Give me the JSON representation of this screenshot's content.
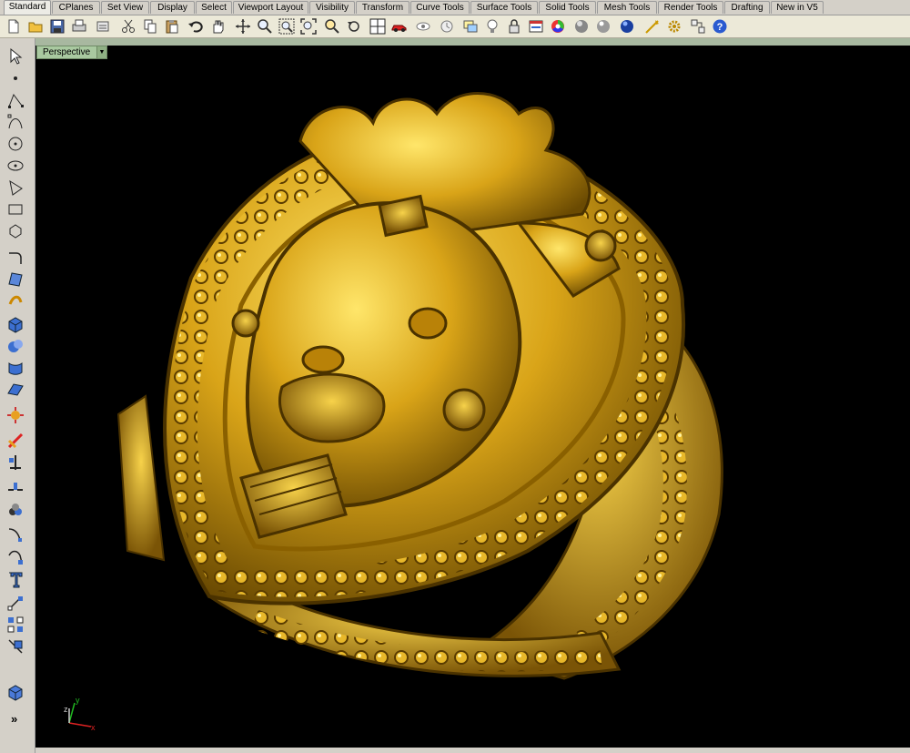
{
  "tabs": [
    {
      "label": "Standard",
      "active": true
    },
    {
      "label": "CPlanes"
    },
    {
      "label": "Set View"
    },
    {
      "label": "Display"
    },
    {
      "label": "Select"
    },
    {
      "label": "Viewport Layout"
    },
    {
      "label": "Visibility"
    },
    {
      "label": "Transform"
    },
    {
      "label": "Curve Tools"
    },
    {
      "label": "Surface Tools"
    },
    {
      "label": "Solid Tools"
    },
    {
      "label": "Mesh Tools"
    },
    {
      "label": "Render Tools"
    },
    {
      "label": "Drafting"
    },
    {
      "label": "New in V5"
    }
  ],
  "toolbar_icons": [
    "new-file-icon",
    "open-folder-icon",
    "save-icon",
    "print-icon",
    "import-icon",
    "cut-icon",
    "copy-icon",
    "paste-icon",
    "undo-icon",
    "pan-hand-icon",
    "rotate-view-icon",
    "zoom-icon",
    "zoom-window-icon",
    "zoom-extents-icon",
    "zoom-selected-icon",
    "undo-view-icon",
    "four-viewports-icon",
    "car-icon",
    "show-icon",
    "lock-icon",
    "layer-icon",
    "light-bulb-icon",
    "padlock-icon",
    "properties-icon",
    "color-wheel-icon",
    "sphere-shaded-icon",
    "sphere-rendered-icon",
    "globe-icon",
    "render-icon",
    "options-gear-icon",
    "toolbar-layout-icon",
    "help-icon"
  ],
  "left_tools": [
    "select-arrow-icon",
    "point-icon",
    "polyline-icon",
    "curve-icon",
    "circle-icon",
    "ellipse-icon",
    "polygon-icon",
    "rectangle-icon",
    "arc-icon",
    "fillet-curve-icon",
    "surface-corner-icon",
    "extrude-icon",
    "box-solid-icon",
    "boolean-icon",
    "loft-icon",
    "plane-surface-icon",
    "explode-icon",
    "trim-icon",
    "split-icon",
    "blend-icon",
    "offset-icon",
    "text-icon",
    "move-icon",
    "array-icon",
    "transform-icon",
    "box-3d-icon"
  ],
  "viewport": {
    "label": "Perspective",
    "background": "#000000",
    "accent_gold": "#d8a418",
    "label_bg": "#a9c9a0"
  },
  "axes": {
    "x": "x",
    "y": "y",
    "z": "z"
  },
  "more_tools_glyph": "»"
}
